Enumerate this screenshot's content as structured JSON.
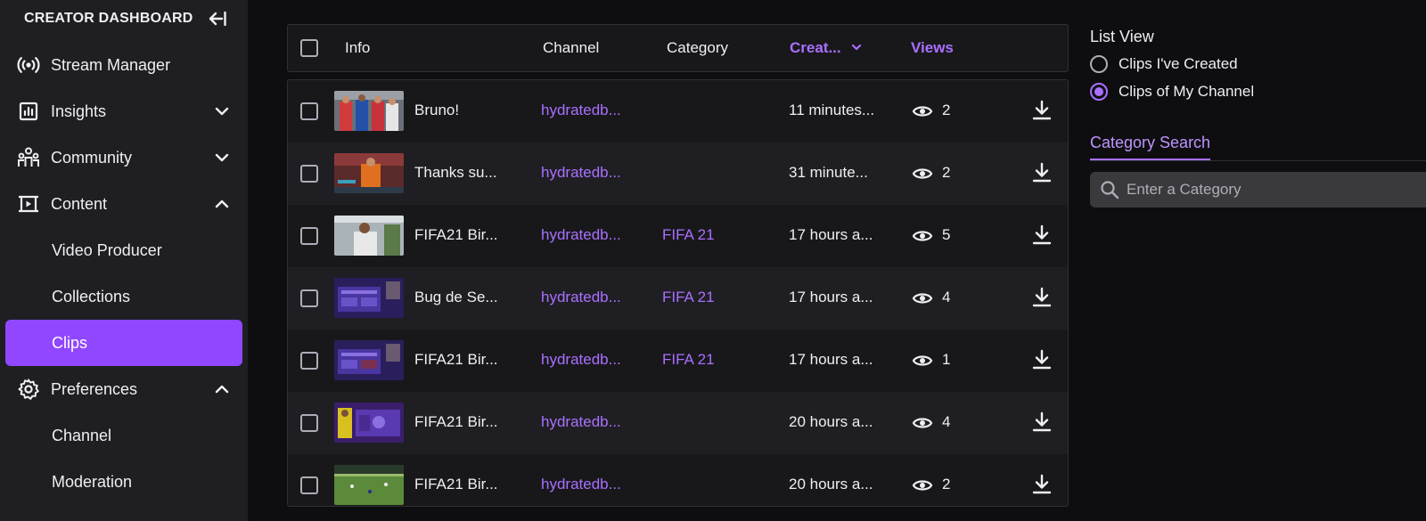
{
  "sidebar": {
    "title": "CREATOR DASHBOARD",
    "items": [
      {
        "label": "Stream Manager",
        "icon": "broadcast-icon"
      },
      {
        "label": "Insights",
        "icon": "chart-icon",
        "chevron": "down"
      },
      {
        "label": "Community",
        "icon": "community-icon",
        "chevron": "down"
      },
      {
        "label": "Content",
        "icon": "content-icon",
        "chevron": "up"
      },
      {
        "label": "Video Producer"
      },
      {
        "label": "Collections"
      },
      {
        "label": "Clips",
        "active": true
      },
      {
        "label": "Preferences",
        "icon": "gear-icon",
        "chevron": "up"
      },
      {
        "label": "Channel"
      },
      {
        "label": "Moderation"
      }
    ]
  },
  "table": {
    "headers": {
      "info": "Info",
      "channel": "Channel",
      "category": "Category",
      "created": "Creat...",
      "views": "Views"
    },
    "rows": [
      {
        "title": "Bruno!",
        "channel": "hydratedb...",
        "category": "",
        "created": "11 minutes...",
        "views": "2"
      },
      {
        "title": "Thanks su...",
        "channel": "hydratedb...",
        "category": "",
        "created": "31 minute...",
        "views": "2"
      },
      {
        "title": "FIFA21 Bir...",
        "channel": "hydratedb...",
        "category": "FIFA 21",
        "created": "17 hours a...",
        "views": "5"
      },
      {
        "title": "Bug de Se...",
        "channel": "hydratedb...",
        "category": "FIFA 21",
        "created": "17 hours a...",
        "views": "4"
      },
      {
        "title": "FIFA21 Bir...",
        "channel": "hydratedb...",
        "category": "FIFA 21",
        "created": "17 hours a...",
        "views": "1"
      },
      {
        "title": "FIFA21 Bir...",
        "channel": "hydratedb...",
        "category": "",
        "created": "20 hours a...",
        "views": "4"
      },
      {
        "title": "FIFA21 Bir...",
        "channel": "hydratedb...",
        "category": "",
        "created": "20 hours a...",
        "views": "2"
      }
    ]
  },
  "right_panel": {
    "list_view_title": "List View",
    "options": [
      {
        "label": "Clips I've Created",
        "selected": false
      },
      {
        "label": "Clips of My Channel",
        "selected": true
      }
    ],
    "tab_label": "Category Search",
    "search_placeholder": "Enter a Category"
  },
  "colors": {
    "accent": "#9147ff",
    "link": "#a970ff",
    "background": "#0e0e10",
    "sidebar": "#1f1f23"
  }
}
